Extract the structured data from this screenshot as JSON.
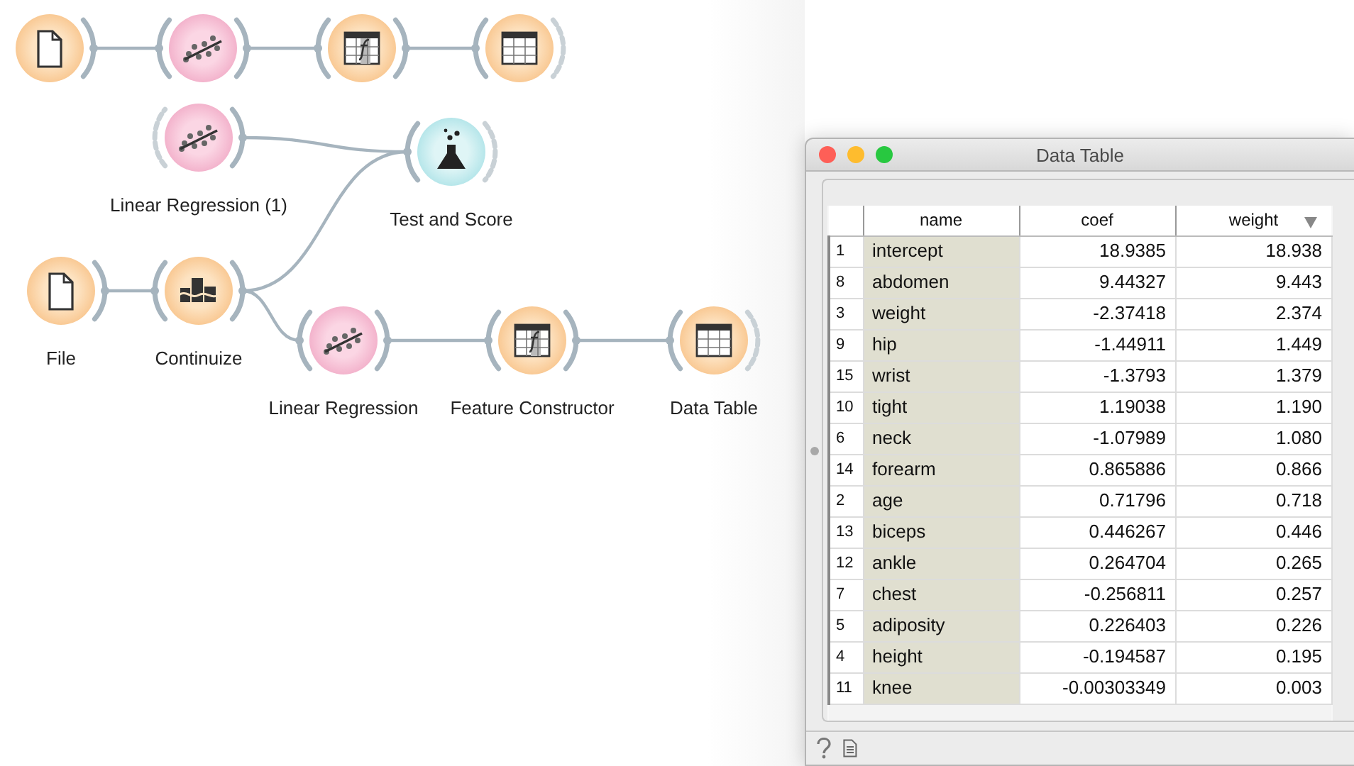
{
  "canvas": {
    "nodes": [
      {
        "kind": "file",
        "output_linked": true
      },
      {
        "kind": "regression",
        "input_linked": true,
        "output_linked": true
      },
      {
        "kind": "feature",
        "input_linked": true,
        "output_linked": true
      },
      {
        "kind": "table",
        "input_linked": true,
        "output_linked": false
      },
      {
        "kind": "regression",
        "label": "Linear Regression (1)",
        "input_linked": false,
        "output_linked": true
      },
      {
        "kind": "test",
        "label": "Test and Score",
        "input_linked": true,
        "output_linked": false
      },
      {
        "kind": "file",
        "label": "File",
        "output_linked": true
      },
      {
        "kind": "continuize",
        "label": "Continuize",
        "input_linked": true,
        "output_linked": true
      },
      {
        "kind": "regression",
        "label": "Linear Regression",
        "input_linked": true,
        "output_linked": true
      },
      {
        "kind": "feature",
        "label": "Feature Constructor",
        "input_linked": true,
        "output_linked": true
      },
      {
        "kind": "table",
        "label": "Data Table",
        "input_linked": true,
        "output_linked": false
      }
    ]
  },
  "window": {
    "title": "Data Table",
    "columns": [
      {
        "label": "name"
      },
      {
        "label": "coef"
      },
      {
        "label": "weight",
        "sorted_descending": true
      }
    ],
    "rows": [
      {
        "index": "1",
        "name": "intercept",
        "coef": "18.9385",
        "weight": "18.938"
      },
      {
        "index": "8",
        "name": "abdomen",
        "coef": "9.44327",
        "weight": "9.443"
      },
      {
        "index": "3",
        "name": "weight",
        "coef": "-2.37418",
        "weight": "2.374"
      },
      {
        "index": "9",
        "name": "hip",
        "coef": "-1.44911",
        "weight": "1.449"
      },
      {
        "index": "15",
        "name": "wrist",
        "coef": "-1.3793",
        "weight": "1.379"
      },
      {
        "index": "10",
        "name": "tight",
        "coef": "1.19038",
        "weight": "1.190"
      },
      {
        "index": "6",
        "name": "neck",
        "coef": "-1.07989",
        "weight": "1.080"
      },
      {
        "index": "14",
        "name": "forearm",
        "coef": "0.865886",
        "weight": "0.866"
      },
      {
        "index": "2",
        "name": "age",
        "coef": "0.71796",
        "weight": "0.718"
      },
      {
        "index": "13",
        "name": "biceps",
        "coef": "0.446267",
        "weight": "0.446"
      },
      {
        "index": "12",
        "name": "ankle",
        "coef": "0.264704",
        "weight": "0.265"
      },
      {
        "index": "7",
        "name": "chest",
        "coef": "-0.256811",
        "weight": "0.257"
      },
      {
        "index": "5",
        "name": "adiposity",
        "coef": "0.226403",
        "weight": "0.226"
      },
      {
        "index": "4",
        "name": "height",
        "coef": "-0.194587",
        "weight": "0.195"
      },
      {
        "index": "11",
        "name": "knee",
        "coef": "-0.00303349",
        "weight": "0.003"
      }
    ]
  }
}
